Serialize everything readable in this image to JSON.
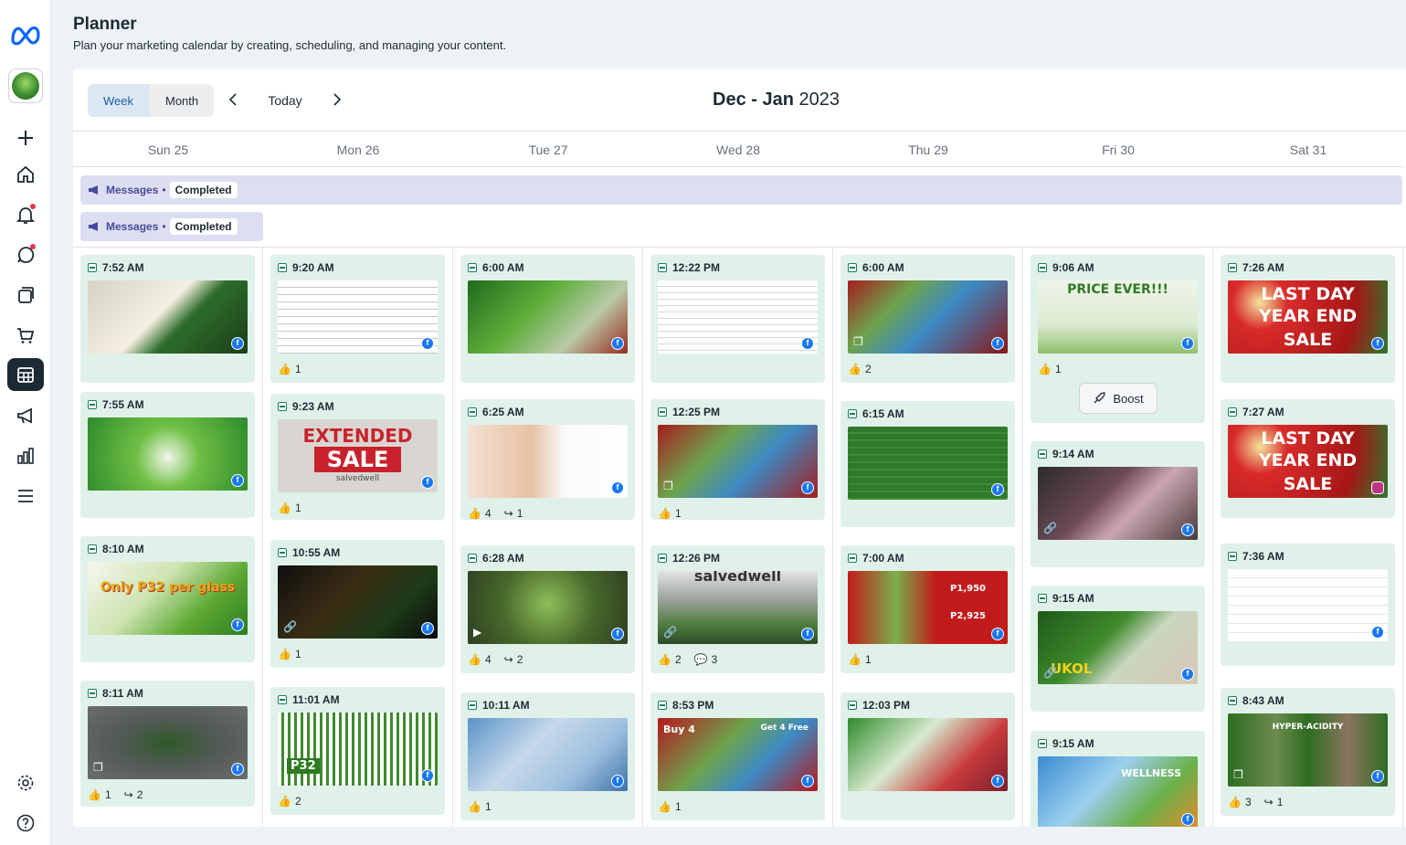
{
  "header": {
    "title": "Planner",
    "subtitle": "Plan your marketing calendar by creating, scheduling, and managing your content."
  },
  "toolbar": {
    "week_label": "Week",
    "month_label": "Month",
    "today_label": "Today",
    "range_bold": "Dec - Jan",
    "range_year": "2023"
  },
  "days": [
    "Sun 25",
    "Mon 26",
    "Tue 27",
    "Wed 28",
    "Thu 29",
    "Fri 30",
    "Sat 31"
  ],
  "messages": [
    {
      "label": "Messages",
      "status": "Completed"
    },
    {
      "label": "Messages",
      "status": "Completed"
    }
  ],
  "posts": {
    "sun": [
      {
        "time": "7:52 AM",
        "likes": "",
        "shares": "",
        "comments": ""
      },
      {
        "time": "7:55 AM",
        "likes": "",
        "shares": "",
        "comments": ""
      },
      {
        "time": "8:10 AM",
        "likes": "",
        "shares": "",
        "comments": "",
        "text": "Only P32 per glass"
      },
      {
        "time": "8:11 AM",
        "likes": "1",
        "shares": "2",
        "comments": ""
      }
    ],
    "mon": [
      {
        "time": "9:20 AM",
        "likes": "1"
      },
      {
        "time": "9:23 AM",
        "likes": "1",
        "text1": "EXTENDED",
        "text2": "SALE",
        "text3": "salvedwell"
      },
      {
        "time": "10:55 AM",
        "likes": "1"
      },
      {
        "time": "11:01 AM",
        "likes": "2",
        "text": "P32"
      }
    ],
    "tue": [
      {
        "time": "6:00 AM"
      },
      {
        "time": "6:25 AM",
        "likes": "4",
        "shares": "1"
      },
      {
        "time": "6:28 AM",
        "likes": "4",
        "shares": "2"
      },
      {
        "time": "10:11 AM",
        "likes": "1"
      }
    ],
    "wed": [
      {
        "time": "12:22 PM"
      },
      {
        "time": "12:25 PM",
        "likes": "1"
      },
      {
        "time": "12:26 PM",
        "likes": "2",
        "comments": "3",
        "text": "salvedwell"
      },
      {
        "time": "8:53 PM",
        "likes": "1",
        "text1": "Buy 4",
        "text2": "Get 4 Free"
      }
    ],
    "thu": [
      {
        "time": "6:00 AM",
        "likes": "2"
      },
      {
        "time": "6:15 AM"
      },
      {
        "time": "7:00 AM",
        "likes": "1",
        "price1": "P1,950",
        "price2": "P2,925"
      },
      {
        "time": "12:03 PM"
      }
    ],
    "fri": [
      {
        "time": "9:06 AM",
        "likes": "1",
        "text": "PRICE EVER!!!",
        "boost": "Boost"
      },
      {
        "time": "9:14 AM"
      },
      {
        "time": "9:15 AM",
        "text": "UKOL"
      },
      {
        "time": "9:15 AM",
        "text": "WELLNESS"
      }
    ],
    "sat": [
      {
        "time": "7:26 AM",
        "text1": "LAST DAY",
        "text2": "YEAR END",
        "text3": "SALE"
      },
      {
        "time": "7:27 AM",
        "text1": "LAST DAY",
        "text2": "YEAR END",
        "text3": "SALE"
      },
      {
        "time": "7:36 AM"
      },
      {
        "time": "8:43 AM",
        "likes": "3",
        "shares": "1",
        "text": "HYPER-ACIDITY"
      }
    ]
  }
}
